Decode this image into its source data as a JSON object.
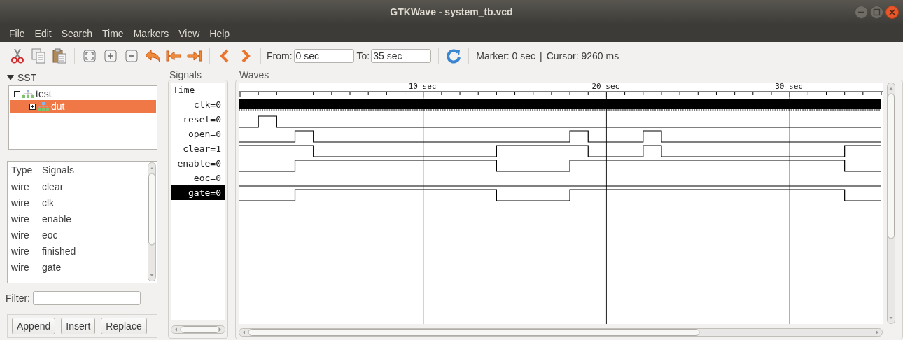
{
  "window": {
    "title": "GTKWave - system_tb.vcd"
  },
  "menu": [
    "File",
    "Edit",
    "Search",
    "Time",
    "Markers",
    "View",
    "Help"
  ],
  "toolbar": {
    "from_label": "From:",
    "from_value": "0 sec",
    "to_label": "To:",
    "to_value": "35 sec",
    "marker": "Marker: 0 sec",
    "divider": "|",
    "cursor": "Cursor: 9260 ms"
  },
  "sst": {
    "title": "SST",
    "expanded": true,
    "tree": [
      {
        "label": "test",
        "expanded": true,
        "selected": false,
        "children": [
          {
            "label": "dut",
            "expanded": false,
            "selected": true
          }
        ]
      }
    ],
    "columns": [
      "Type",
      "Signals"
    ],
    "rows": [
      [
        "wire",
        "clear"
      ],
      [
        "wire",
        "clk"
      ],
      [
        "wire",
        "enable"
      ],
      [
        "wire",
        "eoc"
      ],
      [
        "wire",
        "finished"
      ],
      [
        "wire",
        "gate"
      ]
    ],
    "filter_label": "Filter:",
    "buttons": [
      "Append",
      "Insert",
      "Replace"
    ]
  },
  "signals_panel": {
    "title": "Signals",
    "time_label": "Time",
    "signals": [
      {
        "name": "clk",
        "value": "=0",
        "kind": "clock",
        "selected": false
      },
      {
        "name": "reset",
        "value": "=0",
        "kind": "wire",
        "selected": false
      },
      {
        "name": "open",
        "value": "=0",
        "kind": "wire",
        "selected": false
      },
      {
        "name": "clear",
        "value": "=1",
        "kind": "wire",
        "selected": false
      },
      {
        "name": "enable",
        "value": "=0",
        "kind": "wire",
        "selected": false
      },
      {
        "name": "eoc",
        "value": "=0",
        "kind": "wire",
        "selected": false
      },
      {
        "name": "gate",
        "value": "=0",
        "kind": "wire",
        "selected": true
      }
    ]
  },
  "waves": {
    "title": "Waves",
    "ruler_labels": [
      "10 sec",
      "20 sec",
      "30 sec"
    ]
  }
}
